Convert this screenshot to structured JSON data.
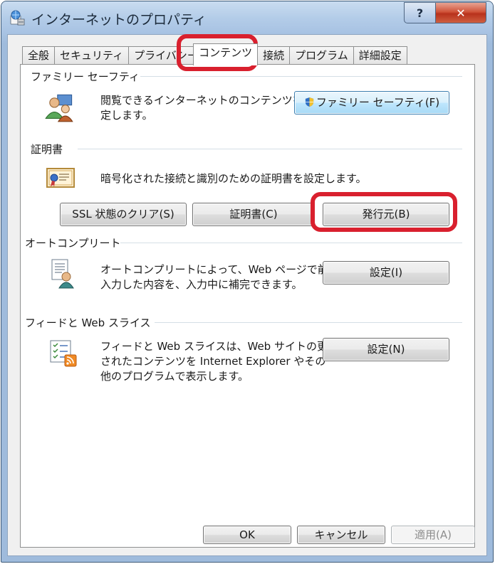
{
  "window": {
    "title": "インターネットのプロパティ",
    "help_label": "?",
    "close_label": "✕"
  },
  "tabs": [
    {
      "label": "全般"
    },
    {
      "label": "セキュリティ"
    },
    {
      "label": "プライバシー"
    },
    {
      "label": "コンテンツ",
      "active": true
    },
    {
      "label": "接続"
    },
    {
      "label": "プログラム"
    },
    {
      "label": "詳細設定"
    }
  ],
  "family_safety": {
    "title": "ファミリー セーフティ",
    "desc_line1": "閲覧できるインターネットのコンテンツを指",
    "desc_line2": "定します。",
    "button_label": "ファミリー セーフティ(F)"
  },
  "certificates": {
    "title": "証明書",
    "desc": "暗号化された接続と識別のための証明書を設定します。",
    "ssl_button": "SSL 状態のクリア(S)",
    "cert_button": "証明書(C)",
    "publisher_button": "発行元(B)"
  },
  "autocomplete": {
    "title": "オートコンプリート",
    "desc_line1": "オートコンプリートによって、Web ページで前回",
    "desc_line2": "入力した内容を、入力中に補完できます。",
    "settings_button": "設定(I)"
  },
  "feeds": {
    "title": "フィードと Web スライス",
    "desc_line1": "フィードと Web スライスは、Web サイトの更新",
    "desc_line2": "されたコンテンツを Internet Explorer やその",
    "desc_line3": "他のプログラムで表示します。",
    "settings_button": "設定(N)"
  },
  "footer": {
    "ok": "OK",
    "cancel": "キャンセル",
    "apply": "適用(A)"
  },
  "colors": {
    "highlight": "#d9202e",
    "accent": "#3c7fb1"
  }
}
